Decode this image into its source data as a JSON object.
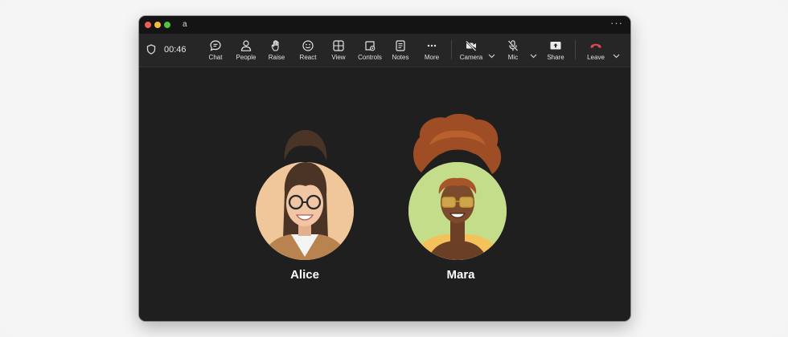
{
  "window": {
    "title": "a",
    "more_label": "···"
  },
  "toolbar": {
    "timer": "00:46",
    "items": [
      {
        "label": "Chat"
      },
      {
        "label": "People"
      },
      {
        "label": "Raise"
      },
      {
        "label": "React"
      },
      {
        "label": "View"
      },
      {
        "label": "Controls"
      },
      {
        "label": "Notes"
      },
      {
        "label": "More"
      },
      {
        "label": "Camera"
      },
      {
        "label": "Mic"
      },
      {
        "label": "Share"
      },
      {
        "label": "Leave"
      }
    ]
  },
  "participants": [
    {
      "name": "Alice"
    },
    {
      "name": "Mara"
    }
  ],
  "colors": {
    "leave": "#e5484d",
    "alice_bg": "#efc79a",
    "mara_bg": "#c4dd8a"
  }
}
